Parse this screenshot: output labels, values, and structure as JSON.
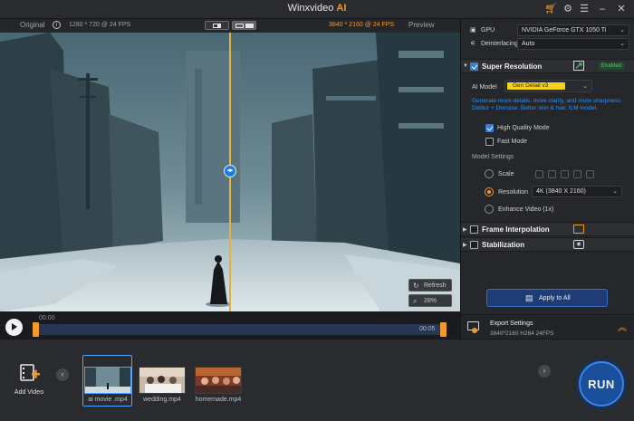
{
  "app": {
    "title": "Winxvideo",
    "title_suffix": "AI"
  },
  "preview": {
    "original_label": "Original",
    "info_icon_glyph": "i",
    "left_resolution": "1280 * 720 @ 24 FPS",
    "right_resolution": "3840 * 2160 @ 24 FPS",
    "preview_label": "Preview",
    "refresh_label": "Refresh",
    "zoom_label": "28%",
    "split_position": 0.5
  },
  "timeline": {
    "current_time": "00:00",
    "end_time": "00:05"
  },
  "library": {
    "add_video_label": "Add Video",
    "videos": [
      {
        "name": "ai movie .mp4",
        "selected": true
      },
      {
        "name": "wedding.mp4",
        "selected": false
      },
      {
        "name": "homemade.mp4",
        "selected": false
      }
    ],
    "run_label": "RUN"
  },
  "panel": {
    "gpu_label": "GPU",
    "gpu_value": "NVIDIA GeForce GTX 1050 Ti",
    "deinterlacing_label": "Deinterlacing",
    "deinterlacing_value": "Auto",
    "super_resolution": {
      "title": "Super Resolution",
      "status": "Enabled",
      "ai_model_label": "AI Model",
      "ai_model_value": "Gen Detail v3",
      "description": "Generate more details, more clarity, and more sharpness. Deblur + Denoise. Better skin & hair. ILM model.",
      "high_quality_label": "High Quality Mode",
      "high_quality_checked": true,
      "fast_mode_label": "Fast Mode",
      "fast_mode_checked": false,
      "model_settings_label": "Model Settings",
      "scale_label": "Scale",
      "resolution_label": "Resolution",
      "resolution_value": "4K (3840 X 2160)",
      "enhance_label": "Enhance Video (1x)"
    },
    "frame_interpolation_title": "Frame Interpolation",
    "stabilization_title": "Stabilization",
    "apply_label": "Apply to All",
    "export": {
      "title": "Export Settings",
      "details": "3840*2160  H264  24FPS"
    }
  },
  "colors": {
    "accent": "#f29a2e",
    "link_blue": "#2f8ff0",
    "enabled_green": "#4fc36a",
    "run_blue": "#1a4f9c"
  }
}
